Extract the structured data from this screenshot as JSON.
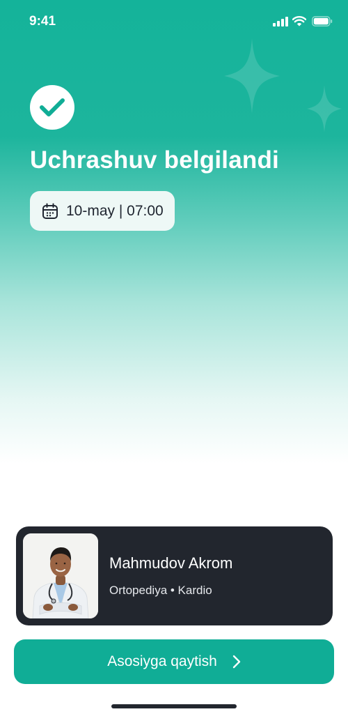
{
  "status_bar": {
    "time": "9:41",
    "icons": [
      "cellular-signal-icon",
      "wifi-icon",
      "battery-icon"
    ]
  },
  "confirmation": {
    "icon": "check-icon",
    "title": "Uchrashuv belgilandi",
    "date_icon": "calendar-icon",
    "datetime": "10-may | 07:00"
  },
  "doctor": {
    "name": "Mahmudov Akrom",
    "specialty": "Ortopediya • Kardio"
  },
  "cta": {
    "label": "Asosiyga qaytish",
    "icon": "chevron-right-icon"
  },
  "colors": {
    "accent": "#10ad96",
    "card_dark": "#22262e",
    "chip_bg": "#eef8f6"
  }
}
